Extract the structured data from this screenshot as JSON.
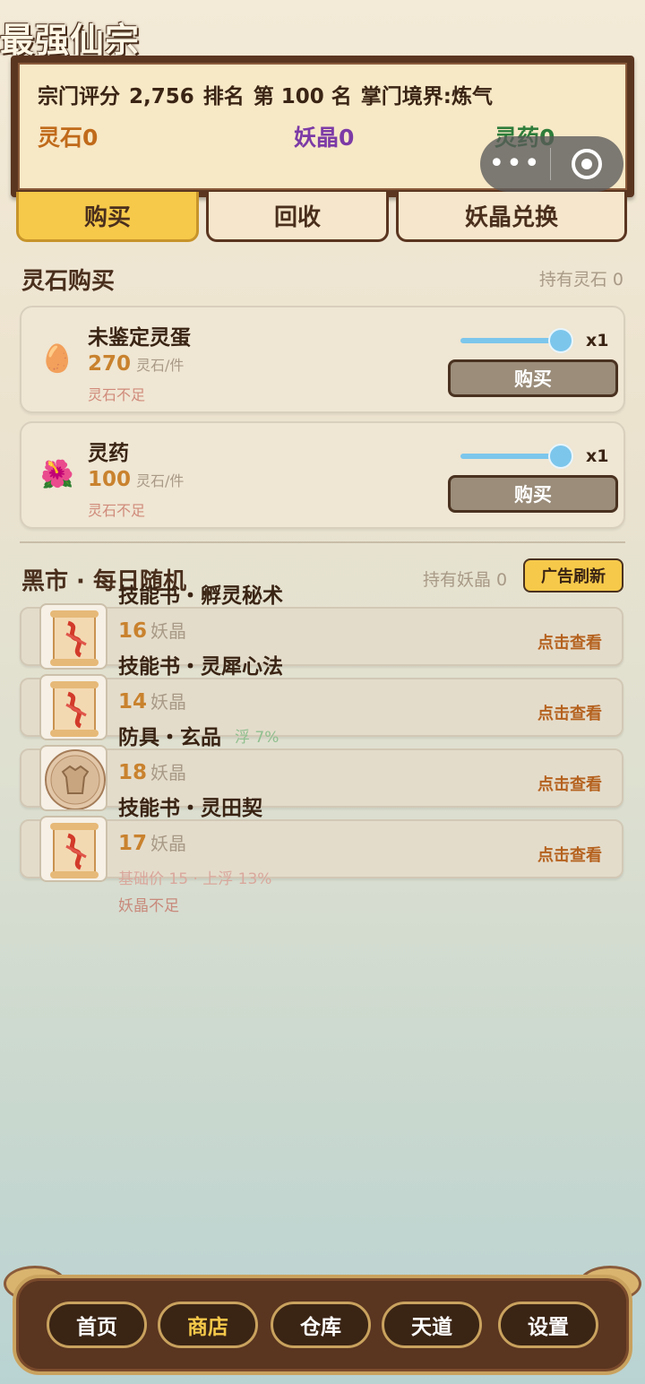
{
  "app_title": "最强仙宗",
  "header": {
    "score_label": "宗门评分",
    "score_value": "2,756",
    "rank_label": "排名",
    "rank_value": "第 100 名",
    "realm": "掌门境界:炼气",
    "spirit_stone": "灵石0",
    "demon_crystal": "妖晶0",
    "spirit_herb": "灵药0"
  },
  "tabs": [
    {
      "label": "购买",
      "active": true
    },
    {
      "label": "回收",
      "active": false
    },
    {
      "label": "妖晶兑换",
      "active": false
    }
  ],
  "stone_shop": {
    "title": "灵石购买",
    "holding": "持有灵石 0",
    "items": [
      {
        "name": "未鉴定灵蛋",
        "price": "270",
        "unit": "灵石/件",
        "status": "灵石不足",
        "qty": "x1",
        "buy_label": "购买",
        "icon": "egg-icon",
        "slider_fraction": 1.0
      },
      {
        "name": "灵药",
        "price": "100",
        "unit": "灵石/件",
        "status": "灵石不足",
        "qty": "x1",
        "buy_label": "购买",
        "icon": "herb-icon",
        "slider_fraction": 1.0
      }
    ]
  },
  "black_market": {
    "title": "黑市 · 每日随机",
    "holding": "持有妖晶 0",
    "refresh_label": "广告刷新",
    "view_label": "点击查看",
    "items": [
      {
        "name": "技能书・孵灵秘术",
        "price": "16",
        "unit": "妖晶",
        "base_note": "",
        "status": "",
        "icon": "scroll-icon"
      },
      {
        "name": "技能书・灵犀心法",
        "price": "14",
        "unit": "妖晶",
        "base_note": "",
        "status": "",
        "icon": "scroll-icon"
      },
      {
        "name": "防具・玄品",
        "price": "18",
        "unit": "妖晶",
        "base_note": "浮 7%",
        "status": "",
        "icon": "armor-icon"
      },
      {
        "name": "技能书・灵田契",
        "price": "17",
        "unit": "妖晶",
        "base_note": "基础价 15 · 上浮 13%",
        "status": "妖晶不足",
        "icon": "scroll-icon"
      }
    ]
  },
  "nav": [
    {
      "label": "首页",
      "active": false
    },
    {
      "label": "商店",
      "active": true
    },
    {
      "label": "仓库",
      "active": false
    },
    {
      "label": "天道",
      "active": false
    },
    {
      "label": "设置",
      "active": false
    }
  ],
  "colors": {
    "accent_gold": "#f6c94a",
    "stone_color": "#c06a1a",
    "crystal_color": "#7c3aa6",
    "herb_color": "#2e7d3a",
    "frame_brown": "#5a3520"
  }
}
